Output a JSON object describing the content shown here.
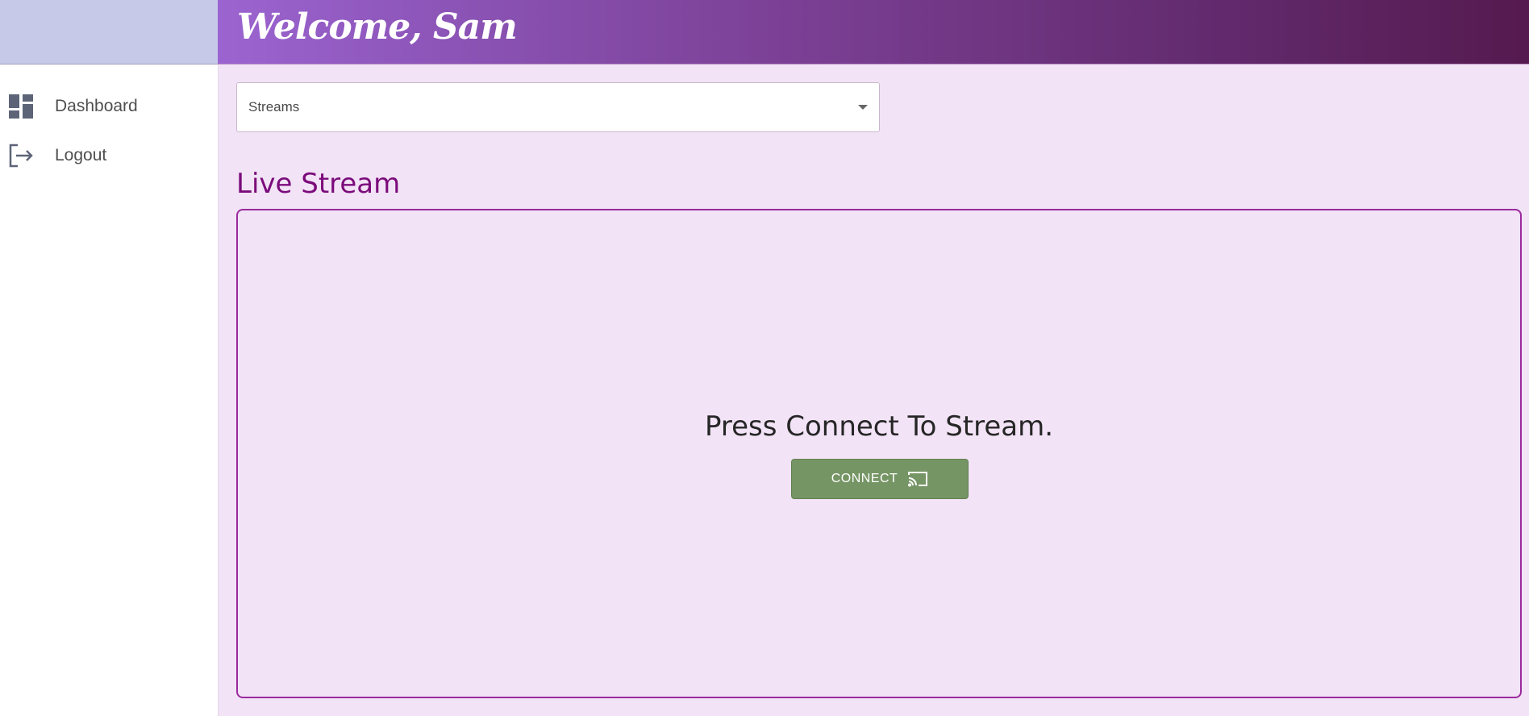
{
  "header": {
    "title": "Welcome, Sam"
  },
  "sidebar": {
    "items": [
      {
        "label": "Dashboard",
        "icon": "dashboard-icon"
      },
      {
        "label": "Logout",
        "icon": "logout-icon"
      }
    ]
  },
  "stream_select": {
    "value": "Streams"
  },
  "live_stream": {
    "title": "Live Stream",
    "message": "Press Connect To Stream.",
    "connect_label": "CONNECT",
    "connect_icon": "cast-icon"
  },
  "colors": {
    "accent": "#7b0b7b",
    "page_background": "#f2e3f6",
    "connect_button": "#769565"
  }
}
